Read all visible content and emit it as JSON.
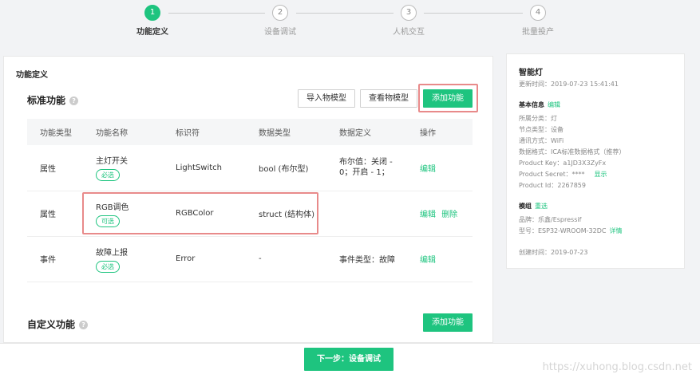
{
  "steps": [
    {
      "num": "1",
      "label": "功能定义"
    },
    {
      "num": "2",
      "label": "设备调试"
    },
    {
      "num": "3",
      "label": "人机交互"
    },
    {
      "num": "4",
      "label": "批量投产"
    }
  ],
  "main": {
    "section_title": "功能定义",
    "standard_title": "标准功能",
    "help_icon": "?",
    "import_btn": "导入物模型",
    "view_btn": "查看物模型",
    "add_btn": "添加功能",
    "columns": [
      "功能类型",
      "功能名称",
      "标识符",
      "数据类型",
      "数据定义",
      "操作"
    ],
    "rows": [
      {
        "type": "属性",
        "name": "主灯开关",
        "tag": "必选",
        "id": "LightSwitch",
        "dtype": "bool (布尔型)",
        "def1": "布尔值：关闭 -",
        "def2": "0；开启 - 1；",
        "op1": "编辑",
        "op2": ""
      },
      {
        "type": "属性",
        "name": "RGB调色",
        "tag": "可选",
        "id": "RGBColor",
        "dtype": "struct (结构体)",
        "def1": "",
        "def2": "",
        "op1": "编辑",
        "op2": "删除"
      },
      {
        "type": "事件",
        "name": "故障上报",
        "tag": "必选",
        "id": "Error",
        "dtype": "-",
        "def1": "事件类型：故障",
        "def2": "",
        "op1": "编辑",
        "op2": ""
      }
    ],
    "custom_title": "自定义功能",
    "custom_add_btn": "添加功能"
  },
  "side": {
    "title": "智能灯",
    "updated": "更新时间：2019-07-23 15:41:41",
    "basic_title": "基本信息",
    "edit": "编辑",
    "category": "所属分类：灯",
    "node_type": "节点类型：设备",
    "comm": "通讯方式：WiFi",
    "data_format": "数据格式：ICA标准数据格式（推荐）",
    "product_key": "Product Key：a1JD3X3ZyFx",
    "product_secret": "Product Secret：****",
    "show": "显示",
    "product_id": "Product Id：2267859",
    "module_title": "模组",
    "module_change": "重选",
    "brand": "品牌：乐鑫/Espressif",
    "model": "型号：ESP32-WROOM-32DC",
    "detail": "详情",
    "created": "创建时间：2019-07-23"
  },
  "footer": {
    "next_btn": "下一步：设备调试",
    "watermark": "https://xuhong.blog.csdn.net"
  },
  "colors": {
    "accent": "#1ec47f",
    "highlight": "#e88a8a"
  }
}
